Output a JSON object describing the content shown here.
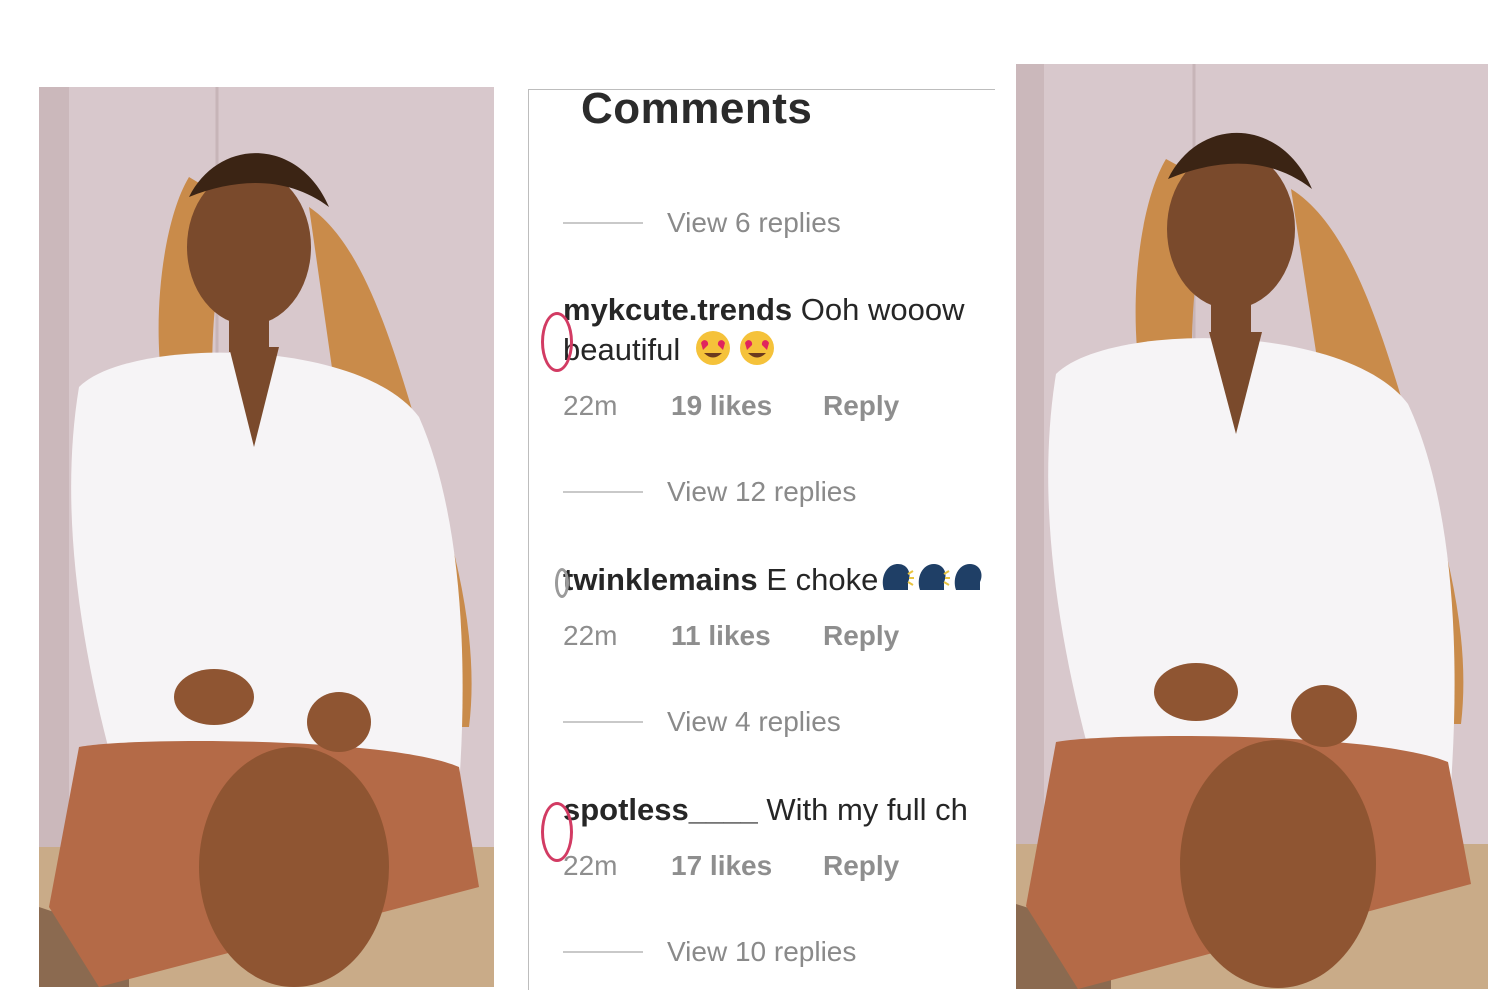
{
  "panel": {
    "title": "Comments",
    "view_replies": [
      "View 6 replies",
      "View 12 replies",
      "View 4 replies",
      "View 10 replies"
    ]
  },
  "comments": [
    {
      "username": "mykcute.trends",
      "text": "Ooh wooow",
      "text2": "beautiful",
      "emoji": "heart-eyes-emoji",
      "time": "22m",
      "likes": "19 likes",
      "reply": "Reply"
    },
    {
      "username": "twinklemains",
      "text": "E choke",
      "emoji": "speaking-head-emoji",
      "time": "22m",
      "likes": "11 likes",
      "reply": "Reply"
    },
    {
      "username": "spotless____",
      "text": "With my full ch",
      "time": "22m",
      "likes": "17 likes",
      "reply": "Reply"
    }
  ],
  "colors": {
    "text": "#262626",
    "muted": "#8e8e8e",
    "avatar_ring": "#d23b63",
    "wall": "#d9c9cc",
    "shirt": "#f6f4f6",
    "shorts": "#b46a47",
    "hair": "#c98b4a"
  }
}
